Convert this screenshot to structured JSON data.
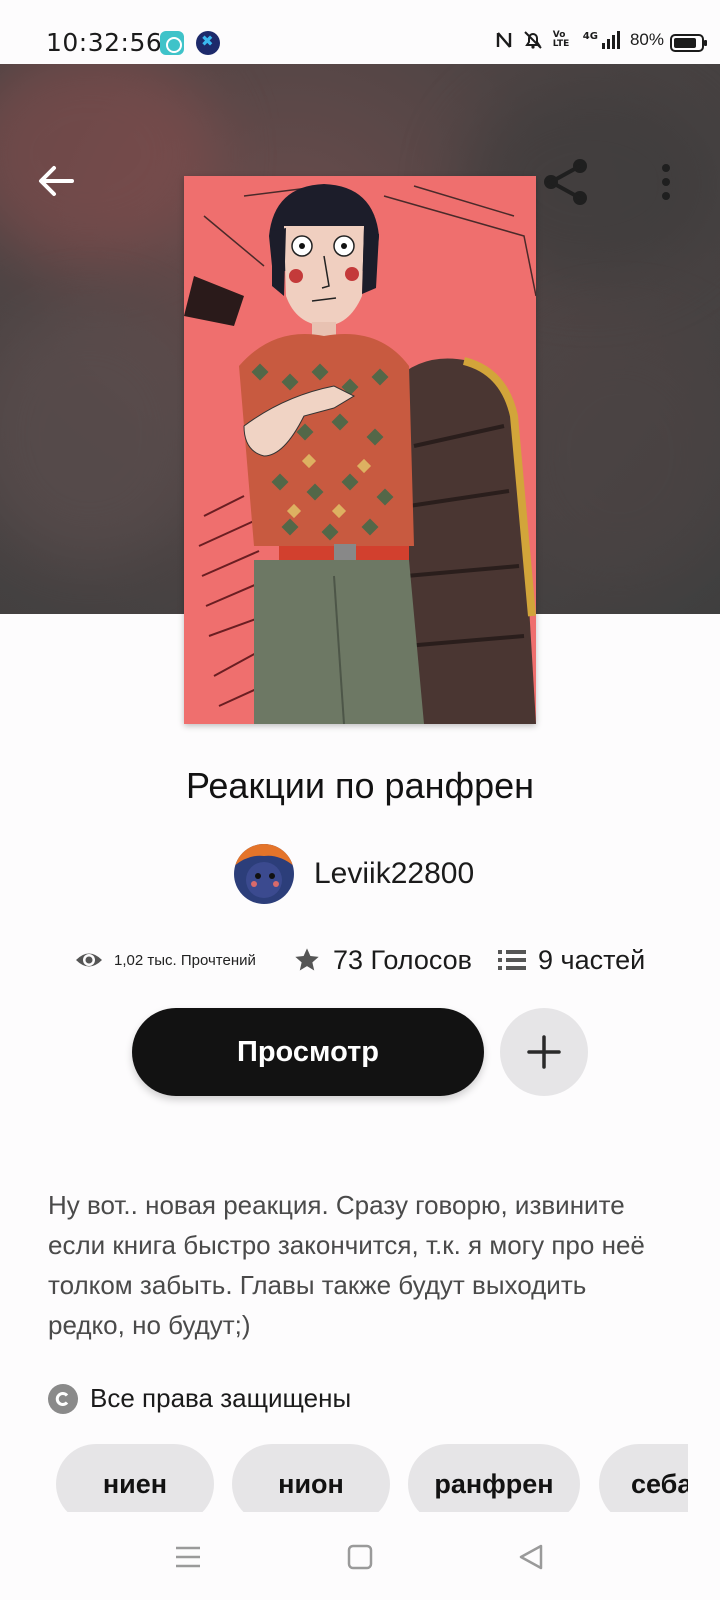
{
  "status_bar": {
    "time": "10:32:56",
    "icons": [
      "nfc-icon",
      "mute-icon",
      "volte-icon",
      "signal-4g-icon"
    ],
    "volte_label": "Vo LTE",
    "network_label": "4G",
    "battery": "80%"
  },
  "header": {
    "back_icon": "arrow-left-icon",
    "share_icon": "share-icon",
    "more_icon": "more-vertical-icon"
  },
  "book": {
    "title": "Реакции по ранфрен",
    "author": "Leviik22800",
    "reads": "1,02 тыс. Прочтений",
    "votes": "73 Голосов",
    "parts": "9 частей"
  },
  "actions": {
    "read_label": "Просмотр",
    "add_icon": "plus-icon"
  },
  "description": "Ну вот.. новая реакция. Сразу говорю, извините если книга быстро закончится, т.к. я могу про неё толком забыть. Главы также будут выходить редко, но будут;)",
  "copyright": {
    "text": "Все права защищены"
  },
  "tags": [
    "ниен",
    "нион",
    "ранфрен",
    "себа"
  ],
  "nav_bar": {
    "items": [
      "menu-icon",
      "home-square-icon",
      "back-triangle-icon"
    ]
  },
  "colors": {
    "accent_dark": "#121212",
    "secondary_button": "#e6e5e7",
    "cover_background": "#ef6f6e"
  }
}
